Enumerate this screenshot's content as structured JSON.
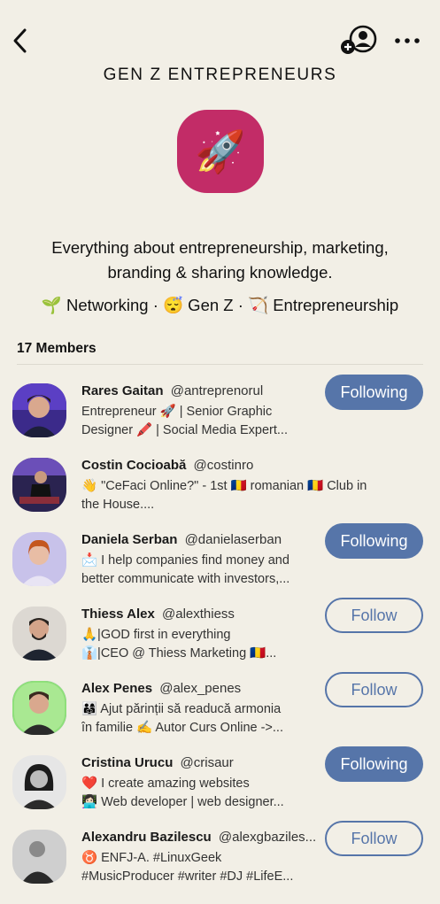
{
  "club": {
    "title": "GEN Z ENTREPRENEURS",
    "logo_emoji": "🚀",
    "description_line1": "Everything about entrepreneurship, marketing,",
    "description_line2": "branding & sharing knowledge.",
    "topics": "🌱 Networking · 😴 Gen Z · 🏹 Entrepreneurship"
  },
  "members_header": "17 Members",
  "members": [
    {
      "name": "Rares Gaitan",
      "handle": "@antreprenorul",
      "bio1": "Entrepreneur 🚀 | Senior Graphic",
      "bio2": "Designer 🖍️ | Social Media Expert...",
      "button": "Following",
      "state": "following"
    },
    {
      "name": "Costin Cocioabă",
      "handle": "@costinro",
      "bio1": "👋 \"CeFaci Online?\" - 1st 🇷🇴 romanian 🇷🇴 Club in",
      "bio2": "the House....",
      "button": "",
      "state": "none"
    },
    {
      "name": "Daniela Serban",
      "handle": "@danielaserban",
      "bio1": "📩 I help companies find money and",
      "bio2": "better communicate with investors,...",
      "button": "Following",
      "state": "following"
    },
    {
      "name": "Thiess Alex",
      "handle": "@alexthiess",
      "bio1": "🙏|GOD first in everything",
      "bio2": "👔|CEO @ Thiess Marketing 🇷🇴...",
      "button": "Follow",
      "state": "follow"
    },
    {
      "name": "Alex Penes",
      "handle": "@alex_penes",
      "bio1": "👨‍👩‍👧 Ajut părinții să readucă armonia",
      "bio2": "în familie ✍️ Autor Curs Online ->...",
      "button": "Follow",
      "state": "follow"
    },
    {
      "name": "Cristina Urucu",
      "handle": "@crisaur",
      "bio1": "❤️ I create amazing websites",
      "bio2": "👩🏻‍💻 Web developer | web designer...",
      "button": "Following",
      "state": "following"
    },
    {
      "name": "Alexandru Bazilescu",
      "handle": "@alexgbaziles...",
      "bio1": "♉ ENFJ-A. #LinuxGeek",
      "bio2": "#MusicProducer #writer #DJ #LifeE...",
      "button": "Follow",
      "state": "follow"
    }
  ],
  "colors": {
    "background": "#f2efe6",
    "accent": "#5675a9",
    "club_logo": "#c22c67"
  }
}
